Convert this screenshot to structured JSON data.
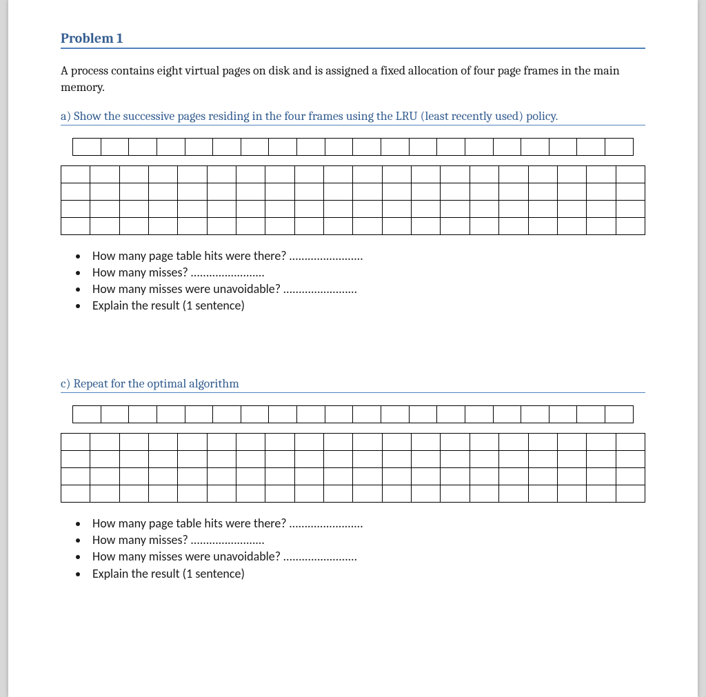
{
  "problem": {
    "title": "Problem 1",
    "statement": "A process contains eight virtual pages on disk and is assigned a fixed allocation of four page frames in the main memory.",
    "dots": "……………………",
    "grid": {
      "reference_columns": 20,
      "frame_rows": 4,
      "frame_columns": 20
    },
    "parts": [
      {
        "id": "a",
        "heading": "a) Show the successive pages residing in the four frames using the LRU (least recently used) policy.",
        "questions": [
          "How many page table hits were there?",
          "How many misses?",
          "How many misses were unavoidable?",
          "Explain the result (1 sentence)"
        ]
      },
      {
        "id": "c",
        "heading": "c) Repeat for the optimal algorithm",
        "questions": [
          "How many page table hits were there?",
          "How many misses?",
          "How many misses were unavoidable?",
          "Explain the result (1 sentence)"
        ]
      }
    ]
  },
  "colors": {
    "heading_blue": "#365f91",
    "rule_blue": "#4f81bd",
    "page_bg": "#ffffff",
    "viewport_bg": "#d8d8d8",
    "grid_border": "#000000"
  }
}
